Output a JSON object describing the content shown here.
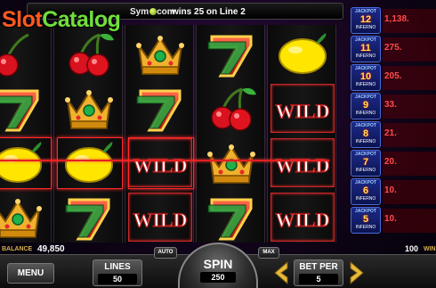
{
  "logo": {
    "part1": "Slot",
    "part2": "Catalog"
  },
  "message": {
    "symbol_prefix": "Sym",
    "symbol_mid": "com",
    "text": "wins 25 on Line 2"
  },
  "reels": [
    [
      "cherry-half",
      "seven",
      "lemon",
      "crown"
    ],
    [
      "cherries",
      "crown",
      "lemon",
      "seven"
    ],
    [
      "crown",
      "seven",
      "wild",
      "wild"
    ],
    [
      "seven",
      "cherries",
      "crown",
      "seven"
    ],
    [
      "lemon",
      "wild",
      "wild",
      "wild"
    ]
  ],
  "wild_label": "WILD",
  "jackpots": [
    {
      "title": "JACKPOT",
      "number": "12",
      "brand": "INFERNO",
      "value": "1,138."
    },
    {
      "title": "JACKPOT",
      "number": "11",
      "brand": "INFERNO",
      "value": "275."
    },
    {
      "title": "JACKPOT",
      "number": "10",
      "brand": "INFERNO",
      "value": "205."
    },
    {
      "title": "JACKPOT",
      "number": "9",
      "brand": "INFERNO",
      "value": "33."
    },
    {
      "title": "JACKPOT",
      "number": "8",
      "brand": "INFERNO",
      "value": "21."
    },
    {
      "title": "JACKPOT",
      "number": "7",
      "brand": "INFERNO",
      "value": "20."
    },
    {
      "title": "JACKPOT",
      "number": "6",
      "brand": "INFERNO",
      "value": "10."
    },
    {
      "title": "JACKPOT",
      "number": "5",
      "brand": "INFERNO",
      "value": "10."
    }
  ],
  "status": {
    "balance_label": "BALANCE",
    "balance": "49,850",
    "win": "100",
    "win_label": "WIN"
  },
  "controls": {
    "menu": "MENU",
    "lines_label": "LINES",
    "lines_value": "50",
    "auto": "AUTO",
    "spin_label": "SPIN",
    "spin_value": "250",
    "max": "MAX",
    "betper_label": "BET PER",
    "betper_value": "5"
  },
  "colors": {
    "payline": "#e42020",
    "jackpot_value": "#ff4b4b",
    "label_gold": "#d7b24a"
  }
}
